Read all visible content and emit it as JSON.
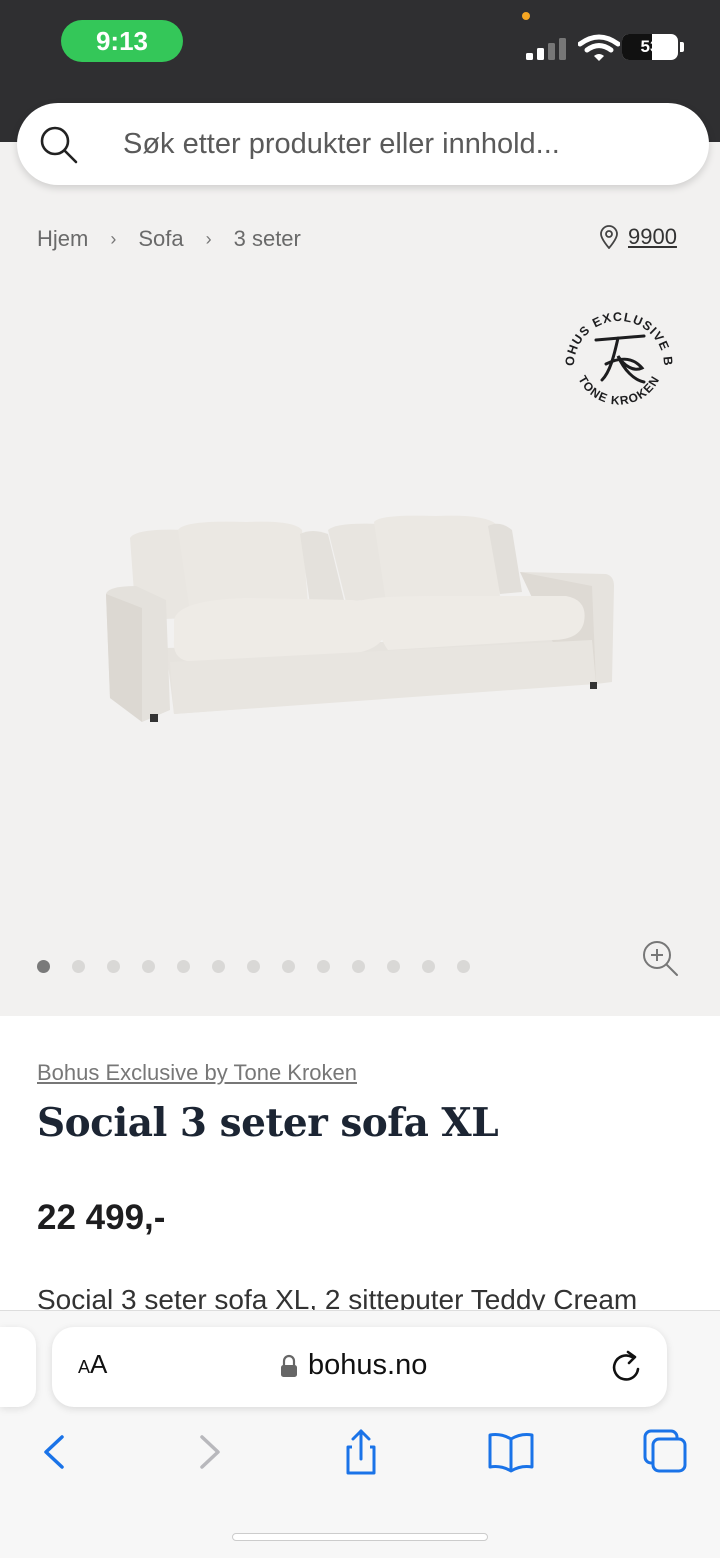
{
  "status_bar": {
    "time": "9:13",
    "battery_level": "53",
    "battery_fraction": 0.53
  },
  "search": {
    "placeholder": "Søk etter produkter eller innhold..."
  },
  "breadcrumb": {
    "items": [
      "Hjem",
      "Sofa",
      "3 seter"
    ],
    "separator": "›"
  },
  "location": {
    "postal_code": "9900"
  },
  "badge": {
    "top_text": "BOHUS EXCLUSIVE BY",
    "bottom_text": "TONE KROKEN",
    "monogram": "TK"
  },
  "carousel": {
    "total_dots": 13,
    "active_index": 0
  },
  "product": {
    "brand": "Bohus Exclusive by Tone Kroken",
    "title": "Social 3 seter sofa XL",
    "price": "22 499,-",
    "description": "Social 3 seter sofa XL, 2 sitteputer Teddy Cream"
  },
  "browser": {
    "aa_label": "AA",
    "url": "bohus.no"
  },
  "colors": {
    "status_bg": "#2f2f31",
    "time_pill": "#34c759",
    "page_bg": "#f2f1f0",
    "title": "#1c2533",
    "ios_blue": "#1a73e8"
  },
  "icons": [
    "search-icon",
    "location-pin-icon",
    "zoom-icon",
    "lock-icon",
    "reload-icon",
    "back-icon",
    "forward-icon",
    "share-icon",
    "bookmarks-icon",
    "tabs-icon"
  ]
}
